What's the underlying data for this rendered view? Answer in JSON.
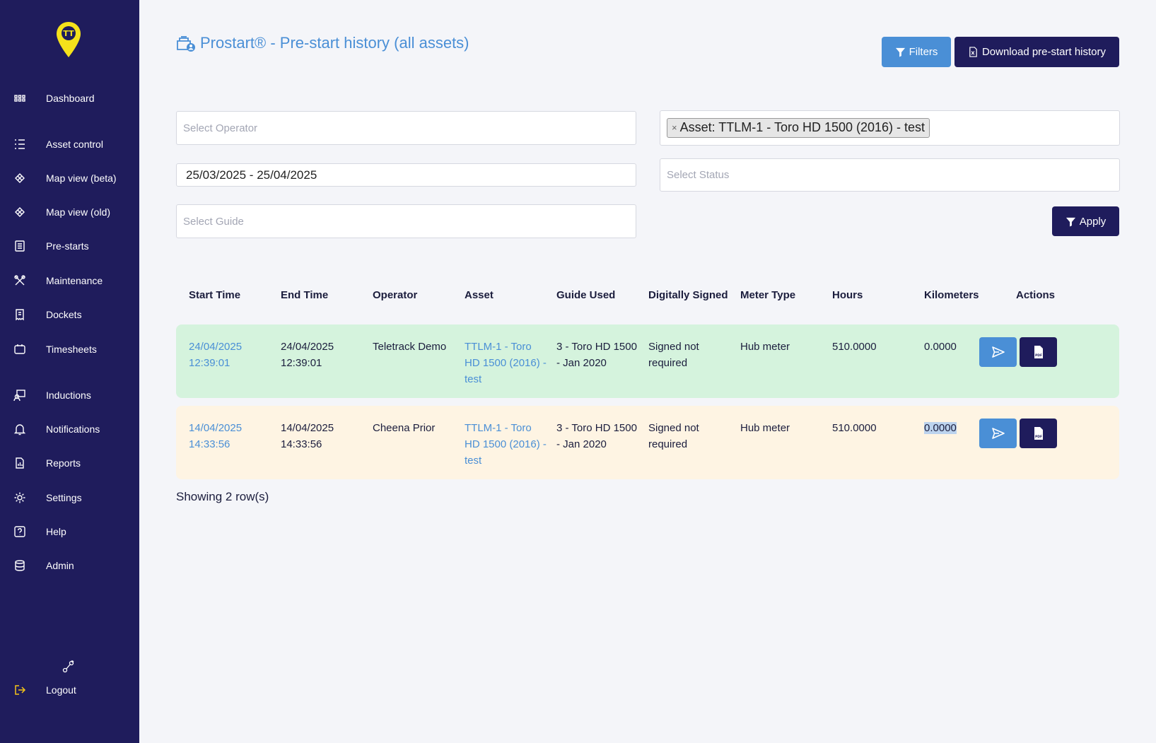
{
  "sidebar": {
    "items": [
      {
        "label": "Dashboard",
        "icon": "grid-icon"
      },
      {
        "label": "Asset control",
        "icon": "list-icon"
      },
      {
        "label": "Map view (beta)",
        "icon": "map-icon"
      },
      {
        "label": "Map view (old)",
        "icon": "map-icon"
      },
      {
        "label": "Pre-starts",
        "icon": "checklist-icon"
      },
      {
        "label": "Maintenance",
        "icon": "tools-icon"
      },
      {
        "label": "Dockets",
        "icon": "receipt-icon"
      },
      {
        "label": "Timesheets",
        "icon": "calendar-icon"
      },
      {
        "label": "Inductions",
        "icon": "induction-icon"
      },
      {
        "label": "Notifications",
        "icon": "bell-icon"
      },
      {
        "label": "Reports",
        "icon": "report-icon"
      },
      {
        "label": "Settings",
        "icon": "gear-icon"
      },
      {
        "label": "Help",
        "icon": "help-icon"
      },
      {
        "label": "Admin",
        "icon": "database-icon"
      }
    ],
    "logout_label": "Logout",
    "logo_text": "TT"
  },
  "header": {
    "title": "Prostart® - Pre-start history (all assets)",
    "filters_label": "Filters",
    "download_label": "Download pre-start history"
  },
  "filters": {
    "operator_placeholder": "Select Operator",
    "asset_tag": "Asset: TTLM-1 - Toro HD 1500 (2016) - test",
    "asset_tag_remove": "×",
    "date_range": "25/03/2025 - 25/04/2025",
    "status_placeholder": "Select Status",
    "guide_placeholder": "Select Guide",
    "apply_label": "Apply"
  },
  "table": {
    "headers": [
      "Start Time",
      "End Time",
      "Operator",
      "Asset",
      "Guide Used",
      "Digitally Signed",
      "Meter Type",
      "Hours",
      "Kilometers",
      "Actions"
    ],
    "rows": [
      {
        "start_time": "24/04/2025 12:39:01",
        "end_time": "24/04/2025 12:39:01",
        "operator": "Teletrack Demo",
        "asset": "TTLM-1 - Toro HD 1500 (2016) - test",
        "guide_used": "3 - Toro HD 1500 - Jan 2020",
        "digitally_signed": "Signed not required",
        "meter_type": "Hub meter",
        "hours": "510.0000",
        "kilometers": "0.0000",
        "status_color": "#d5f3dd"
      },
      {
        "start_time": "14/04/2025 14:33:56",
        "end_time": "14/04/2025 14:33:56",
        "operator": "Cheena Prior",
        "asset": "TTLM-1 - Toro HD 1500 (2016) - test",
        "guide_used": "3 - Toro HD 1500 - Jan 2020",
        "digitally_signed": "Signed not required",
        "meter_type": "Hub meter",
        "hours": "510.0000",
        "kilometers": "0.0000",
        "status_color": "#fef4e3"
      }
    ],
    "footer": "Showing 2 row(s)"
  },
  "colors": {
    "sidebar": "#1f1c5c",
    "accent": "#4a8fd6",
    "logo": "#f5e21b"
  }
}
